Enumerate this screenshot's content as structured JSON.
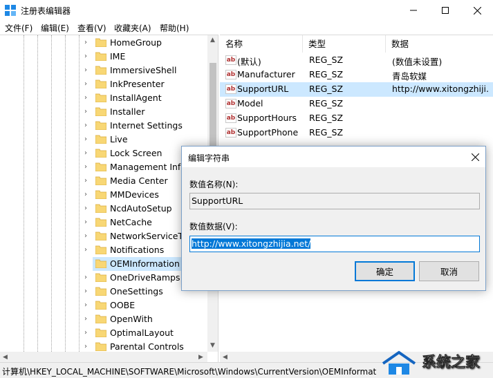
{
  "window": {
    "title": "注册表编辑器",
    "accent_color": "#0078d7",
    "selection_color": "#cce8ff"
  },
  "menu": [
    {
      "label": "文件(F)"
    },
    {
      "label": "编辑(E)"
    },
    {
      "label": "查看(V)"
    },
    {
      "label": "收藏夹(A)"
    },
    {
      "label": "帮助(H)"
    }
  ],
  "tree": {
    "items": [
      {
        "label": "HomeGroup"
      },
      {
        "label": "IME"
      },
      {
        "label": "ImmersiveShell"
      },
      {
        "label": "InkPresenter"
      },
      {
        "label": "InstallAgent"
      },
      {
        "label": "Installer"
      },
      {
        "label": "Internet Settings"
      },
      {
        "label": "Live"
      },
      {
        "label": "Lock Screen"
      },
      {
        "label": "Management Infr"
      },
      {
        "label": "Media Center"
      },
      {
        "label": "MMDevices"
      },
      {
        "label": "NcdAutoSetup"
      },
      {
        "label": "NetCache"
      },
      {
        "label": "NetworkServiceTr"
      },
      {
        "label": "Notifications"
      },
      {
        "label": "OEMInformation",
        "selected": true
      },
      {
        "label": "OneDriveRamps"
      },
      {
        "label": "OneSettings"
      },
      {
        "label": "OOBE"
      },
      {
        "label": "OpenWith"
      },
      {
        "label": "OptimalLayout"
      },
      {
        "label": "Parental Controls"
      }
    ]
  },
  "list": {
    "headers": {
      "name": "名称",
      "type": "类型",
      "data": "数据"
    },
    "rows": [
      {
        "name": "(默认)",
        "type": "REG_SZ",
        "data": "(数值未设置)"
      },
      {
        "name": "Manufacturer",
        "type": "REG_SZ",
        "data": "青岛软媒"
      },
      {
        "name": "SupportURL",
        "type": "REG_SZ",
        "data": "http://www.xitongzhiji...",
        "selected": true
      },
      {
        "name": "Model",
        "type": "REG_SZ",
        "data": ""
      },
      {
        "name": "SupportHours",
        "type": "REG_SZ",
        "data": ""
      },
      {
        "name": "SupportPhone",
        "type": "REG_SZ",
        "data": ""
      }
    ],
    "value_icon": "ab-string-icon"
  },
  "dialog": {
    "title": "编辑字符串",
    "name_label": "数值名称(N):",
    "name_value": "SupportURL",
    "data_label": "数值数据(V):",
    "data_value": "http://www.xitongzhijia.net/",
    "ok_label": "确定",
    "cancel_label": "取消"
  },
  "status": {
    "path": "计算机\\HKEY_LOCAL_MACHINE\\SOFTWARE\\Microsoft\\Windows\\CurrentVersion\\OEMInformat"
  },
  "watermark": {
    "text": "系统之家"
  }
}
